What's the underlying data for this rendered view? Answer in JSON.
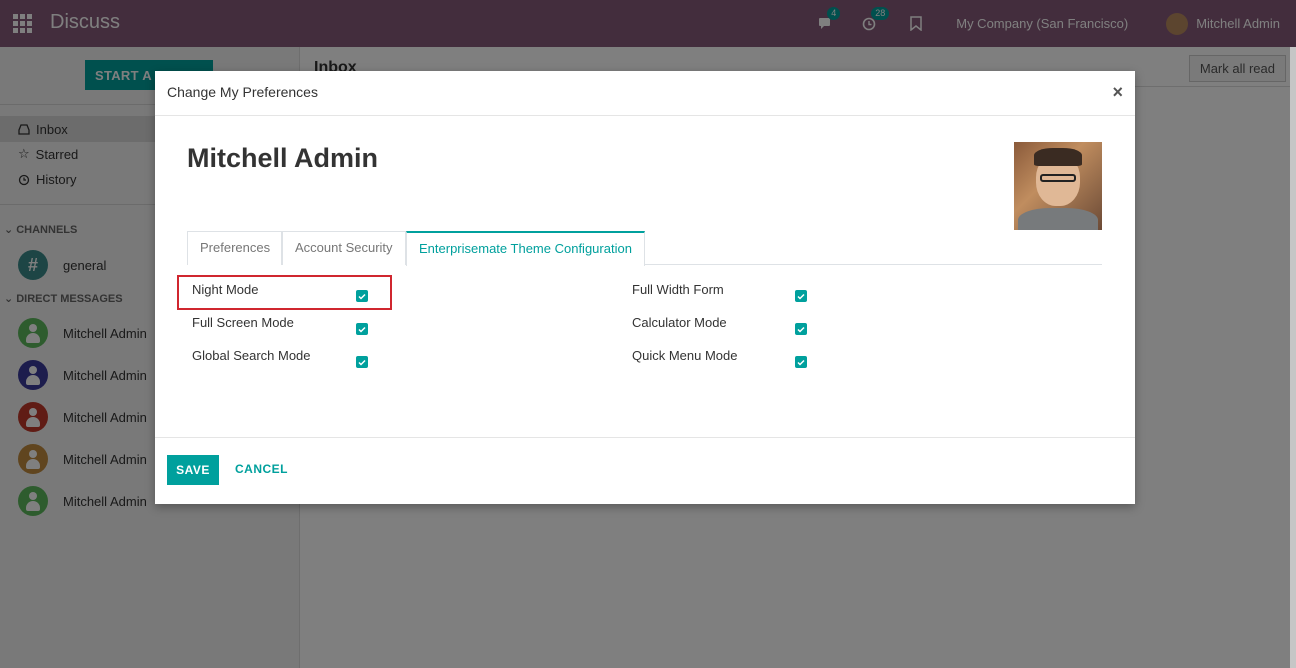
{
  "navbar": {
    "app_title": "Discuss",
    "messages_badge": "4",
    "activities_badge": "28",
    "company": "My Company (San Francisco)",
    "user": "Mitchell Admin"
  },
  "sidebar": {
    "start_button": "START A M",
    "items": [
      {
        "label": "Inbox"
      },
      {
        "label": "Starred"
      },
      {
        "label": "History"
      }
    ],
    "channels_header": "CHANNELS",
    "channel": "general",
    "dm_header": "DIRECT MESSAGES",
    "direct_messages": [
      {
        "name": "Mitchell Admin",
        "color": "#5cb85c"
      },
      {
        "name": "Mitchell Admin",
        "color": "#3b3a9a"
      },
      {
        "name": "Mitchell Admin",
        "color": "#c0392b"
      },
      {
        "name": "Mitchell Admin",
        "color": "#c08a3e"
      },
      {
        "name": "Mitchell Admin",
        "color": "#5cb85c"
      }
    ]
  },
  "main": {
    "title": "Inbox",
    "mark_all_read": "Mark all read"
  },
  "modal": {
    "title": "Change My Preferences",
    "close": "×",
    "user_name": "Mitchell Admin",
    "tabs": [
      {
        "label": "Preferences"
      },
      {
        "label": "Account Security"
      },
      {
        "label": "Enterprisemate Theme Configuration"
      }
    ],
    "fields_left": [
      {
        "label": "Night Mode",
        "checked": true
      },
      {
        "label": "Full Screen Mode",
        "checked": true
      },
      {
        "label": "Global Search Mode",
        "checked": true
      }
    ],
    "fields_right": [
      {
        "label": "Full Width Form",
        "checked": true
      },
      {
        "label": "Calculator Mode",
        "checked": true
      },
      {
        "label": "Quick Menu Mode",
        "checked": true
      }
    ],
    "save": "SAVE",
    "cancel": "CANCEL"
  },
  "colors": {
    "navbar": "#875a7b",
    "accent": "#00a09d",
    "highlight": "#d0262f"
  }
}
